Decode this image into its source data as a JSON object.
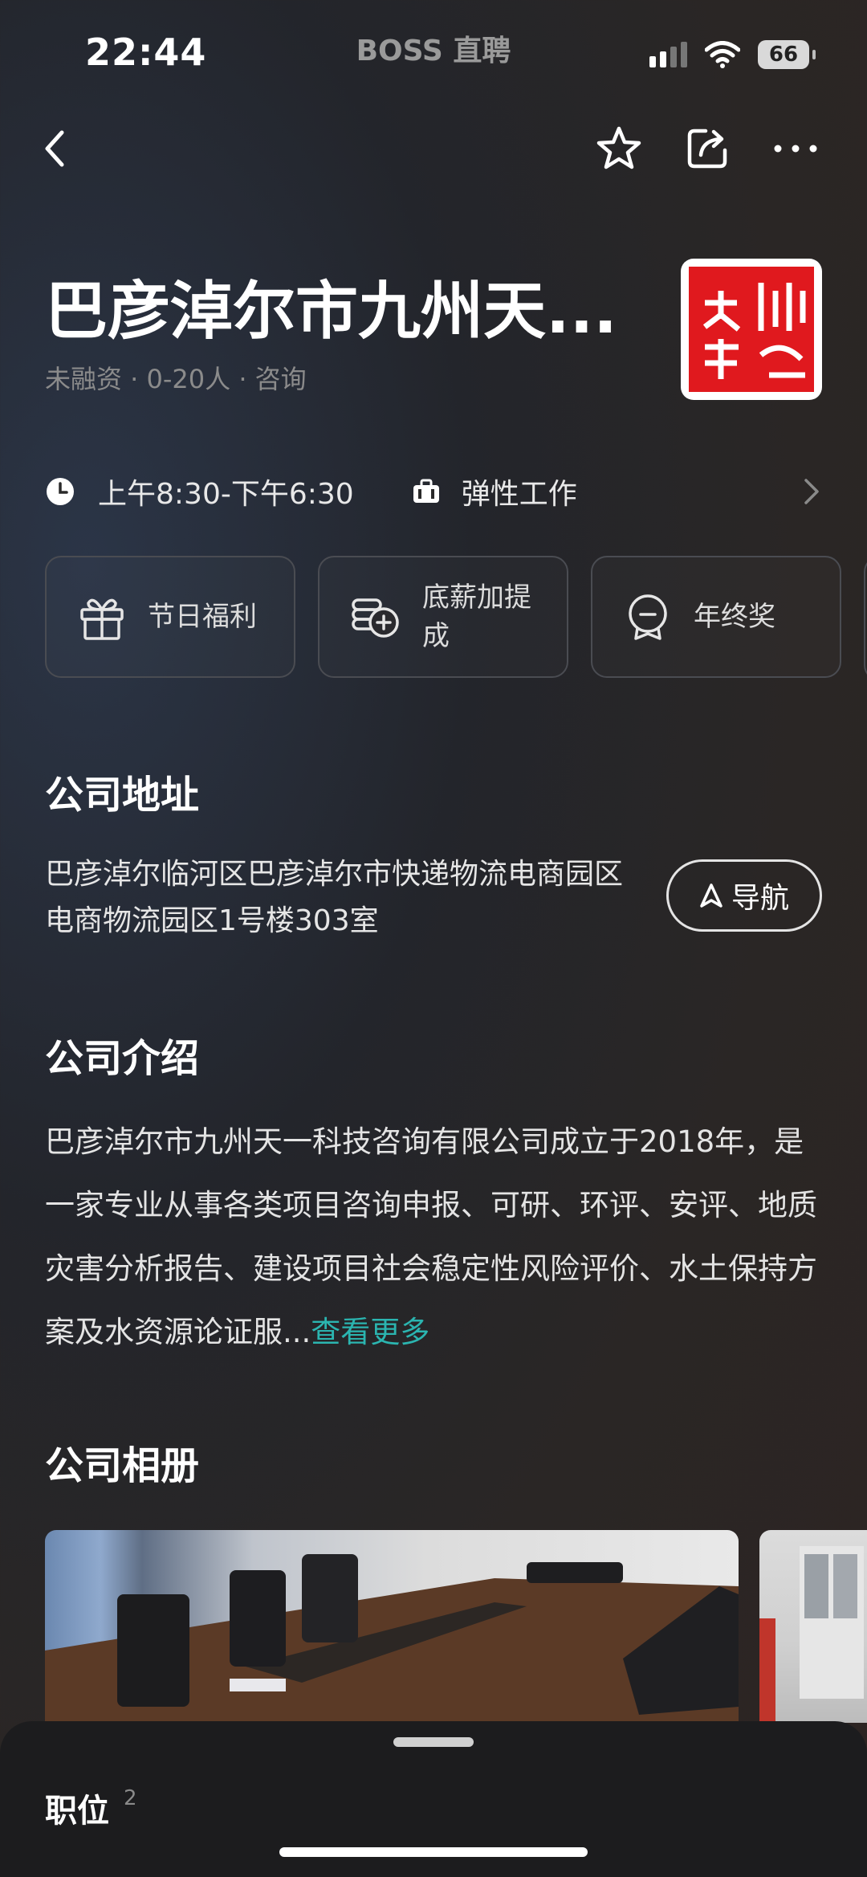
{
  "status_bar": {
    "time": "22:44",
    "app_name": "BOSS 直聘",
    "battery": "66"
  },
  "header": {
    "company_name": "巴彦淖尔市九州天...",
    "meta": "未融资 · 0-20人 · 咨询",
    "work_hours": "上午8:30-下午6:30",
    "work_type": "弹性工作"
  },
  "benefits": [
    {
      "label": "节日福利",
      "icon": "gift-icon"
    },
    {
      "label": "底薪加提成",
      "icon": "coins-icon"
    },
    {
      "label": "年终奖",
      "icon": "medal-icon"
    }
  ],
  "address_section": {
    "title": "公司地址",
    "address": "巴彦淖尔临河区巴彦淖尔市快递物流电商园区电商物流园区1号楼303室",
    "navigate_label": "导航"
  },
  "intro_section": {
    "title": "公司介绍",
    "text": "巴彦淖尔市九州天一科技咨询有限公司成立于2018年，是一家专业从事各类项目咨询申报、可研、环评、安评、地质灾害分析报告、建设项目社会稳定性风险评价、水土保持方案及水资源论证服...",
    "more_label": "查看更多"
  },
  "album_section": {
    "title": "公司相册"
  },
  "bottom_sheet": {
    "title": "职位",
    "count": "2"
  }
}
